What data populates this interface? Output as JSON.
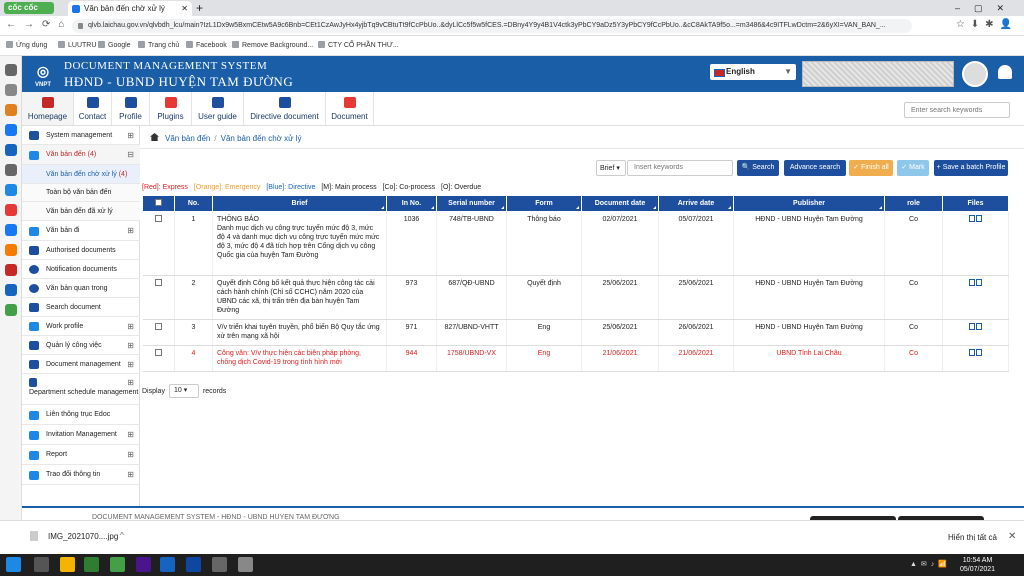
{
  "browser": {
    "brand": "cốc cốc",
    "tab_title": "Văn bản đến chờ xử lý",
    "url": "qlvb.laichau.gov.vn/qlvbdh_lcu/main?IzL1Dx9w5BxmCEtw5A9c6Bnb=CEt1CzAwJyHx4yjbTq9vCBtuTt9fCcPbUo..&dyLlCc5f5w5fCES.=DBny4Y9y4B1V4ctk3yPbCY9aDz5Y3yPbCY9fCcPbUo..&cC8AkTA9f5o...=m3486&4c9ITFLwDctm=2&6yXI=VAN_BAN_...",
    "bookmarks": [
      "Ứng dụng",
      "LUUTRU",
      "Google",
      "Trang chủ",
      "Facebook",
      "Remove Background...",
      "CTY CỔ PHẦN THƯ..."
    ]
  },
  "header": {
    "logo": "VNPT",
    "system_name": "DOCUMENT MANAGEMENT SYSTEM",
    "org_name": "HĐND - UBND HUYỆN TAM ĐƯỜNG",
    "language": "English"
  },
  "toolbar": {
    "items": [
      {
        "label": "Homepage",
        "icon": "home-icon"
      },
      {
        "label": "Contact",
        "icon": "contact-icon"
      },
      {
        "label": "Profile",
        "icon": "profile-icon"
      },
      {
        "label": "Plugins",
        "icon": "plugins-icon"
      },
      {
        "label": "User guide",
        "icon": "user-guide-icon"
      },
      {
        "label": "Directive document",
        "icon": "directive-icon"
      },
      {
        "label": "Document",
        "icon": "document-icon"
      }
    ],
    "search_placeholder": "Enter search keywords"
  },
  "sidebar": {
    "items": [
      {
        "label": "System management",
        "expandable": true
      },
      {
        "label": "Văn bản đến",
        "count": "(4)",
        "expanded": true
      },
      {
        "label": "Văn bản đến chờ xử lý",
        "count": "(4)",
        "selected": true
      },
      {
        "label": "Toàn bộ văn bản đến"
      },
      {
        "label": "Văn bản đến đã xử lý"
      },
      {
        "label": "Văn bản đi",
        "expandable": true
      },
      {
        "label": "Authorised documents"
      },
      {
        "label": "Notification documents"
      },
      {
        "label": "Văn bản quan trong"
      },
      {
        "label": "Search document"
      },
      {
        "label": "Work profile",
        "expandable": true
      },
      {
        "label": "Quản lý công việc",
        "expandable": true
      },
      {
        "label": "Document management",
        "expandable": true
      },
      {
        "label": "Department schedule management",
        "expandable": true
      },
      {
        "label": "Liên thông trục Edoc"
      },
      {
        "label": "Invitation Management",
        "expandable": true
      },
      {
        "label": "Report",
        "expandable": true
      },
      {
        "label": "Trao đổi thông tin",
        "expandable": true
      }
    ]
  },
  "breadcrumb": [
    "Văn bản đến",
    "Văn bản đến chờ xử lý"
  ],
  "search": {
    "brief_label": "Brief",
    "placeholder": "Insert keywords",
    "search_btn": "Search",
    "advance_btn": "Advance search",
    "finish_btn": "Finish all",
    "mark_btn": "Mark",
    "save_btn": "+ Save a batch Profile"
  },
  "legend": [
    {
      "text": "[Red]: Express",
      "color": "#e02020"
    },
    {
      "text": "[Orange]: Emergency",
      "color": "#f0a030"
    },
    {
      "text": "[Blue]: Directive",
      "color": "#1565c0"
    },
    {
      "text": "[M]: Main process",
      "color": "#333333"
    },
    {
      "text": "[Co]: Co-process",
      "color": "#333333"
    },
    {
      "text": "[O]: Overdue",
      "color": "#333333"
    }
  ],
  "table": {
    "columns": [
      "",
      "No.",
      "Brief",
      "In No.",
      "Serial number",
      "Form",
      "Document date",
      "Arrive date",
      "Publisher",
      "role",
      "Files"
    ],
    "rows": [
      {
        "no": "1",
        "brief": "THÔNG BÁO\nDanh mục dịch vụ công trực tuyến mức độ 3, mức độ 4 và danh mục dịch vụ công trực tuyến mức mức độ 3, mức độ 4 đã tích hợp trên Cổng dịch vụ công Quốc gia của huyện Tam Đường",
        "in_no": "1036",
        "serial": "748/TB-UBND",
        "form": "Thông báo",
        "doc_date": "02/07/2021",
        "arrive": "05/07/2021",
        "publisher": "HĐND - UBND Huyện Tam Đường",
        "role": "Co",
        "overdue": false
      },
      {
        "no": "2",
        "brief": "Quyết định Công bố kết quả thực hiện công tác cải cách hành chính (Chỉ số CCHC) năm 2020 của UBND các xã, thị trấn trên địa bàn huyện Tam Đường",
        "in_no": "973",
        "serial": "687/QĐ-UBND",
        "form": "Quyết định",
        "doc_date": "25/06/2021",
        "arrive": "25/06/2021",
        "publisher": "HĐND - UBND Huyện Tam Đường",
        "role": "Co",
        "overdue": false
      },
      {
        "no": "3",
        "brief": "V/v triển khai tuyên truyền, phổ biến Bộ Quy tắc ứng xử trên mạng xã hội",
        "in_no": "971",
        "serial": "827/UBND-VHTT",
        "form": "Eng",
        "doc_date": "25/06/2021",
        "arrive": "26/06/2021",
        "publisher": "HĐND - UBND Huyện Tam Đường",
        "role": "Co",
        "overdue": false
      },
      {
        "no": "4",
        "brief": "Công văn: V/v thực hiện các biện pháp phòng, chống dịch Covid-19 trong tình hình mới",
        "in_no": "944",
        "serial": "1758/UBND-VX",
        "form": "Eng",
        "doc_date": "21/06/2021",
        "arrive": "21/06/2021",
        "publisher": "UBND Tỉnh Lai Châu",
        "role": "Co",
        "overdue": true
      }
    ]
  },
  "pager": {
    "display_label": "Display",
    "value": "10",
    "suffix": "records"
  },
  "footer_text": "DOCUMENT MANAGEMENT SYSTEM - HĐND - UBND HUYỆN TAM ĐƯỜNG",
  "download": {
    "file": "IMG_2021070....jpg",
    "show_all": "Hiển thị tất cả"
  },
  "clock": {
    "time": "10:54 AM",
    "date": "05/07/2021"
  }
}
